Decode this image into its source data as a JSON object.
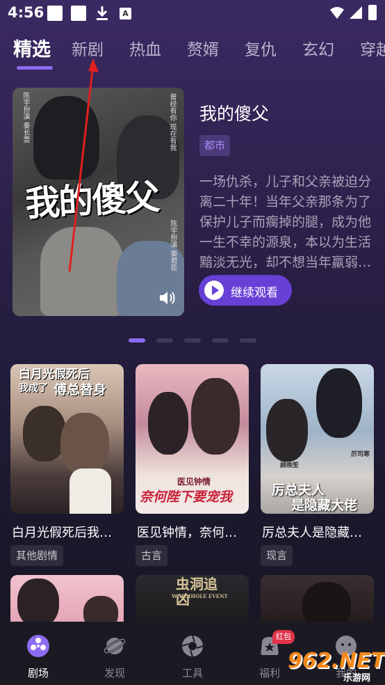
{
  "status_bar": {
    "time": "4:56"
  },
  "tabs": [
    {
      "label": "精选",
      "active": true
    },
    {
      "label": "新剧",
      "active": false
    },
    {
      "label": "热血",
      "active": false
    },
    {
      "label": "赘婿",
      "active": false
    },
    {
      "label": "复仇",
      "active": false
    },
    {
      "label": "玄幻",
      "active": false
    },
    {
      "label": "穿越",
      "active": false
    }
  ],
  "hero": {
    "poster_title": "我的傻父",
    "poster_left_text": "陈宇扮演 秦长壹",
    "poster_right_text": "曾经有你 现在有我",
    "poster_right_text2": "陈宇扮演 秦君臣",
    "title": "我的傻父",
    "tag": "都市",
    "description": "一场仇杀，儿子和父亲被迫分离二十年！当年父亲那条为了保护儿子而瘸掉的腿，成为他一生不幸的源泉，本以为生活黯淡无光，却不想当年羸弱…",
    "continue_label": "继续观看",
    "carousel_count": 5,
    "carousel_active": 1
  },
  "dramas": [
    {
      "title": "白月光假死后我…",
      "tag": "其他剧情",
      "poster_text_1": "白月光假死后",
      "poster_text_2": "我成了",
      "poster_text_3": "傅总替身"
    },
    {
      "title": "医见钟情，奈何…",
      "tag": "古言",
      "poster_text_1": "医见钟情",
      "poster_text_2": "奈何陛下要宠我"
    },
    {
      "title": "厉总夫人是隐藏…",
      "tag": "现言",
      "poster_text_1": "厉总夫人",
      "poster_text_2": "是隐藏大佬",
      "poster_name_1": "厉司寒",
      "poster_name_2": "顾晚笙"
    }
  ],
  "row2": [
    {
      "poster_text": ""
    },
    {
      "poster_text": "虫洞追凶",
      "poster_sub": "WORMHOLE EVENT"
    },
    {
      "poster_text": ""
    }
  ],
  "bottom_nav": [
    {
      "label": "剧场",
      "icon": "film-reel-icon",
      "active": true
    },
    {
      "label": "发现",
      "icon": "planet-icon",
      "active": false
    },
    {
      "label": "工具",
      "icon": "aperture-icon",
      "active": false
    },
    {
      "label": "福利",
      "icon": "gift-bag-icon",
      "active": false,
      "badge": "红包"
    },
    {
      "label": "我的",
      "icon": "profile-icon",
      "active": false
    }
  ],
  "watermark": {
    "main": "962.NET",
    "sub": "乐游网"
  },
  "colors": {
    "accent": "#8c6cf0",
    "button": "#6740d6",
    "badge": "#e0344a",
    "annotation_arrow": "#e02020"
  }
}
